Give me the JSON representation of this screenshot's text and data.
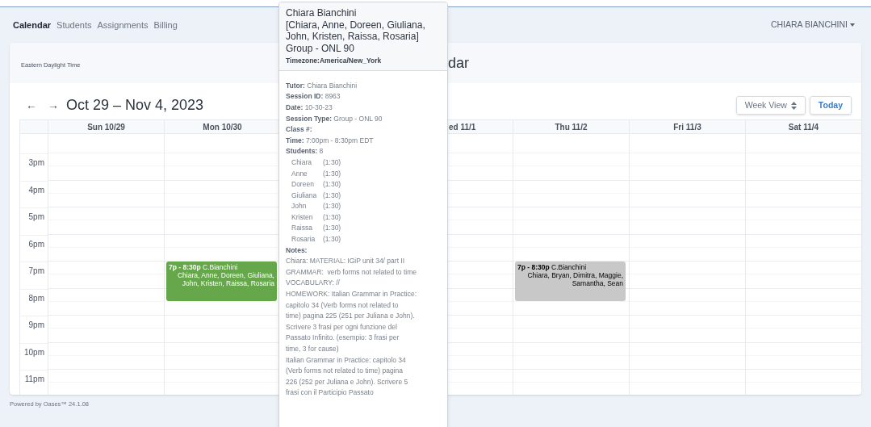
{
  "nav": {
    "tabs": [
      {
        "label": "Calendar",
        "selected": true
      },
      {
        "label": "Students",
        "selected": false
      },
      {
        "label": "Assignments",
        "selected": false
      },
      {
        "label": "Billing",
        "selected": false
      }
    ],
    "user": "CHIARA BIANCHINI"
  },
  "header": {
    "timezone": "Eastern Daylight Time",
    "title": "dar"
  },
  "toolbar": {
    "prev": "←",
    "next": "→",
    "date_range": "Oct 29 – Nov 4, 2023",
    "view_select": "Week View",
    "today_button": "Today"
  },
  "columns": [
    {
      "label": "Sun 10/29",
      "kind": "full"
    },
    {
      "label": "Mon 10/30",
      "kind": "full",
      "events": [
        {
          "time": "7p - 8:30p",
          "tutor": "C.Bianchini",
          "students": "Chiara, Anne, Doreen, Giuliana, John, Kristen, Raissa, Rosaria",
          "color": "#67a74b"
        }
      ]
    },
    {
      "kind": "hidden"
    },
    {
      "label": "ed 11/1",
      "kind": "partial"
    },
    {
      "label": "Thu 11/2",
      "kind": "full",
      "events": [
        {
          "time": "7p - 8:30p",
          "tutor": "C.Bianchini",
          "students": "Chiara, Bryan, Dimitra, Maggie, Samantha, Sean",
          "color": "#c8c8c8"
        }
      ]
    },
    {
      "label": "Fri 11/3",
      "kind": "full"
    },
    {
      "label": "Sat 11/4",
      "kind": "full"
    }
  ],
  "hours": [
    "3pm",
    "4pm",
    "5pm",
    "6pm",
    "7pm",
    "8pm",
    "9pm",
    "10pm",
    "11pm"
  ],
  "footer": "Powered by Oases™ 24.1.08",
  "popover": {
    "title_lines": [
      "Chiara Bianchini",
      "[Chiara, Anne, Doreen, Giuliana,",
      "John, Kristen, Raissa, Rosaria]",
      "Group - ONL 90"
    ],
    "timezone_label": "Timezone:",
    "timezone": "America/New_York",
    "fields": [
      {
        "label": "Tutor:",
        "value": "Chiara Bianchini"
      },
      {
        "label": "Session ID:",
        "value": "8963"
      },
      {
        "label": "Date:",
        "value": "10-30-23"
      },
      {
        "label": "Session Type:",
        "value": "Group - ONL 90"
      },
      {
        "label": "Class #:"
      },
      {
        "label": "Time:",
        "value": "7:00pm - 8:30pm EDT"
      },
      {
        "label": "Students:",
        "value": "8"
      }
    ],
    "students": [
      {
        "name": "Chiara",
        "duration": "(1:30)"
      },
      {
        "name": "Anne",
        "duration": "(1:30)"
      },
      {
        "name": "Doreen",
        "duration": "(1:30)"
      },
      {
        "name": "Giuliana",
        "duration": "(1:30)"
      },
      {
        "name": "John",
        "duration": "(1:30)"
      },
      {
        "name": "Kristen",
        "duration": "(1:30)"
      },
      {
        "name": "Raissa",
        "duration": "(1:30)"
      },
      {
        "name": "Rosaria",
        "duration": "(1:30)"
      }
    ],
    "notes_label": "Notes:",
    "notes_lines": [
      "Chiara: MATERIAL: IGiP unit 34/ part II",
      "GRAMMAR:  verb forms not related to time",
      "VOCABULARY: //",
      "HOMEWORK: Italian Grammar in Practice:",
      "capitolo 34 (Verb forms not related to",
      "time) pagina 225 (251 per Juliana e John).",
      "Scrivere 3 frasi per ogni funzione del",
      "Passato Infinito. (esempio: 3 frasi per",
      "time, 3 for cause)",
      "Italian Grammar in Practice: capitolo 34",
      "(Verb forms not related to time) pagina",
      "226 (252 per Juliana e John). Scrivere 5",
      "frasi con il Participio Passato"
    ]
  }
}
